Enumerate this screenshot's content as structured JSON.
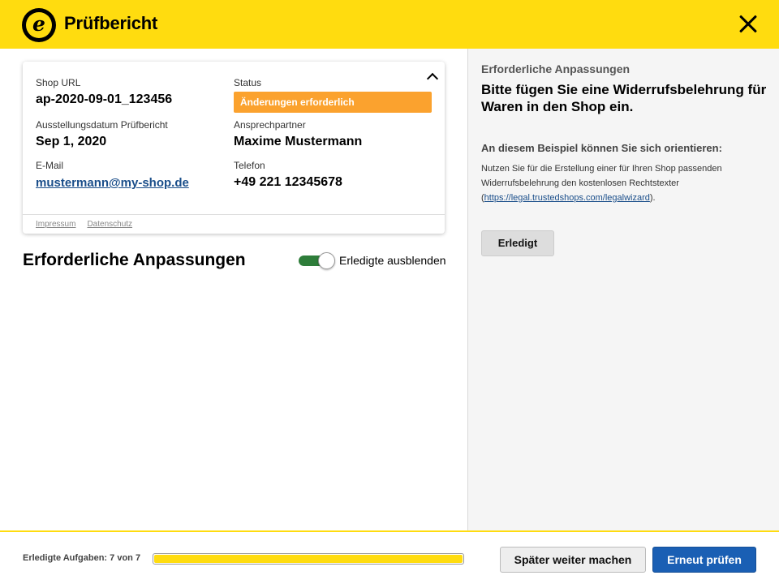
{
  "header": {
    "logo_glyph": "e",
    "title": "Prüfbericht",
    "close_icon": "close-icon"
  },
  "colors": {
    "brand_yellow": "#FFDC0F",
    "status_orange": "#FBA22E",
    "toggle_green": "#2E7D3A",
    "primary_blue": "#1A5FB4",
    "link_blue": "#1a4e8a"
  },
  "card": {
    "shop_url_label": "Shop URL",
    "shop_url_value": "ap-2020-09-01_123456",
    "status_label": "Status",
    "status_value": "Änderungen erforderlich",
    "date_label": "Ausstellungsdatum Prüfbericht",
    "date_value": "Sep 1, 2020",
    "contact_label": "Ansprechpartner",
    "contact_value": "Maxime Mustermann",
    "email_label": "E-Mail",
    "email_value": "mustermann@my-shop.de",
    "phone_label": "Telefon",
    "phone_value": "+49 221 12345678",
    "collapse_icon": "chevron-up-icon",
    "footer_links": [
      "Impressum",
      "Datenschutz"
    ]
  },
  "main": {
    "section_title": "Erforderliche Anpassungen",
    "toggle_label": "Erledigte ausblenden",
    "toggle_on": true
  },
  "detail": {
    "subtitle": "Erforderliche Anpassungen",
    "heading": "Bitte fügen Sie eine Widerrufsbelehrung für Waren in den Shop ein.",
    "example_title": "An diesem Beispiel können Sie sich orientieren:",
    "text_before": "Nutzen Sie für die Erstellung einer für Ihren Shop passenden Widerrufsbelehrung den kostenlosen Rechtstexter (",
    "text_link": "https://legal.trustedshops.com/legalwizard",
    "text_after": ").",
    "done_button": "Erledigt"
  },
  "footer": {
    "progress_label": "Erledigte Aufgaben: 7 von 7",
    "progress_fraction": 1.0,
    "later_button": "Später weiter machen",
    "recheck_button": "Erneut prüfen"
  }
}
